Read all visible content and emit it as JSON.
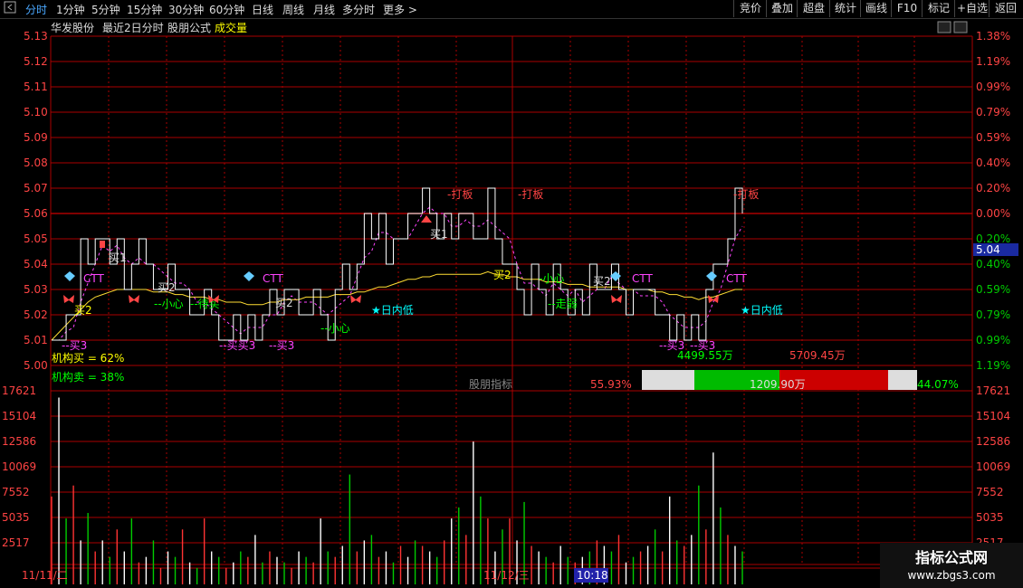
{
  "toolbar": {
    "menu_icon": "menu-icon",
    "tabs": [
      "分时",
      "1分钟",
      "5分钟",
      "15分钟",
      "30分钟",
      "60分钟",
      "日线",
      "周线",
      "月线",
      "多分时",
      "更多"
    ],
    "active_tab": "分时",
    "right_buttons": [
      "竞价",
      "叠加",
      "超盘",
      "统计",
      "画线",
      "F10",
      "标记",
      "+自选",
      "返回"
    ]
  },
  "header": {
    "stock_name": "华发股份",
    "period": "最近2日分时",
    "formula": "股朋公式",
    "volume_label": "成交量"
  },
  "price_axis": {
    "left_labels": [
      "5.13",
      "5.12",
      "5.11",
      "5.10",
      "5.09",
      "5.08",
      "5.07",
      "5.06",
      "5.05",
      "5.04",
      "5.03",
      "5.02",
      "5.01",
      "5.00"
    ],
    "right_labels": [
      "1.38%",
      "1.19%",
      "0.99%",
      "0.79%",
      "0.59%",
      "0.40%",
      "0.20%",
      "0.00%",
      "0.20%",
      "0.40%",
      "0.59%",
      "0.79%",
      "0.99%",
      "1.19%"
    ],
    "current_price": "5.04"
  },
  "volume_axis": {
    "labels": [
      "17621",
      "15104",
      "12586",
      "10069",
      "7552",
      "5035",
      "2517"
    ]
  },
  "annotations": {
    "daban": "打板",
    "buy1": "买1",
    "buy2": "买2",
    "buy3": "买3",
    "buybuy3": "买买3",
    "careful": "小心",
    "ctt": "CTT",
    "intraday_low": "★日内低",
    "wait_buy": "待买",
    "weak": "走弱"
  },
  "stats": {
    "inst_buy": "机构买 = 62%",
    "inst_sell": "机构卖 = 38%",
    "indicator_label": "股朋指标",
    "left_pct": "55.93%",
    "mid_amount": "1209.90万",
    "right_pct": "44.07%",
    "amount_left": "4499.55万",
    "amount_right": "5709.45万"
  },
  "time_axis": {
    "day1": "11/11/二",
    "day2": "11/12/三",
    "cursor_time": "10:18"
  },
  "watermark": {
    "title": "指标公式网",
    "url": "www.zbgs3.com"
  },
  "colors": {
    "red": "#ff3333",
    "green": "#00cc00",
    "yellow": "#ffff00",
    "white": "#ffffff",
    "magenta": "#ff44ff",
    "cyan": "#00ffff",
    "grid": "#aa0000",
    "axis_text": "#ff4444"
  },
  "chart_data": {
    "type": "line",
    "ylim": [
      5.0,
      5.13
    ],
    "price_series": [
      5.01,
      5.01,
      5.02,
      5.02,
      5.05,
      5.04,
      5.05,
      5.05,
      5.04,
      5.05,
      5.03,
      5.04,
      5.05,
      5.04,
      5.03,
      5.03,
      5.04,
      5.03,
      5.03,
      5.02,
      5.02,
      5.03,
      5.02,
      5.01,
      5.01,
      5.02,
      5.01,
      5.02,
      5.01,
      5.02,
      5.03,
      5.02,
      5.03,
      5.03,
      5.02,
      5.02,
      5.03,
      5.02,
      5.01,
      5.03,
      5.04,
      5.03,
      5.04,
      5.06,
      5.05,
      5.06,
      5.04,
      5.05,
      5.05,
      5.06,
      5.06,
      5.07,
      5.06,
      5.05,
      5.06,
      5.05,
      5.06,
      5.06,
      5.05,
      5.05,
      5.07,
      5.05,
      5.04,
      5.04,
      5.03,
      5.02,
      5.04,
      5.03,
      5.02,
      5.04,
      5.03,
      5.02,
      5.03,
      5.02,
      5.04,
      5.03,
      5.03,
      5.04,
      5.03,
      5.02,
      5.03,
      5.03,
      5.03,
      5.02,
      5.02,
      5.01,
      5.02,
      5.01,
      5.02,
      5.01,
      5.03,
      5.04,
      5.04,
      5.05,
      5.07,
      5.06
    ],
    "avg_series": [
      5.01,
      5.013,
      5.016,
      5.019,
      5.022,
      5.025,
      5.027,
      5.028,
      5.029,
      5.03,
      5.03,
      5.03,
      5.03,
      5.03,
      5.029,
      5.029,
      5.029,
      5.028,
      5.028,
      5.027,
      5.027,
      5.027,
      5.026,
      5.026,
      5.025,
      5.025,
      5.025,
      5.024,
      5.024,
      5.024,
      5.025,
      5.025,
      5.026,
      5.026,
      5.026,
      5.027,
      5.027,
      5.027,
      5.027,
      5.028,
      5.028,
      5.028,
      5.029,
      5.029,
      5.03,
      5.031,
      5.031,
      5.032,
      5.033,
      5.034,
      5.034,
      5.035,
      5.035,
      5.036,
      5.036,
      5.036,
      5.036,
      5.036,
      5.036,
      5.036,
      5.037,
      5.036,
      5.036,
      5.035,
      5.035,
      5.034,
      5.034,
      5.034,
      5.033,
      5.033,
      5.033,
      5.032,
      5.032,
      5.032,
      5.031,
      5.031,
      5.031,
      5.031,
      5.031,
      5.03,
      5.03,
      5.03,
      5.03,
      5.029,
      5.029,
      5.028,
      5.028,
      5.027,
      5.027,
      5.026,
      5.027,
      5.027,
      5.028,
      5.029,
      5.03,
      5.03
    ],
    "volume_series": [
      8000,
      17000,
      6000,
      9000,
      4000,
      6500,
      3000,
      4000,
      2500,
      5000,
      3000,
      6000,
      2000,
      2500,
      4000,
      1500,
      3000,
      2500,
      5000,
      2000,
      1500,
      6000,
      3000,
      2500,
      1500,
      2000,
      3000,
      2500,
      4500,
      2000,
      3000,
      2500,
      2000,
      1500,
      3000,
      2500,
      2000,
      6000,
      3000,
      2500,
      3500,
      10000,
      3000,
      4000,
      4500,
      2500,
      3000,
      2000,
      3500,
      2500,
      4000,
      3500,
      3000,
      2500,
      4000,
      6000,
      7000,
      4500,
      13000,
      8000,
      6000,
      3000,
      5000,
      6000,
      4000,
      7500,
      3500,
      3000,
      2500,
      2000,
      3500,
      2500,
      2000,
      2500,
      3000,
      4000,
      3500,
      3000,
      4500,
      2000,
      2500,
      3000,
      3500,
      5000,
      3000,
      8000,
      4000,
      3500,
      4500,
      9000,
      5000,
      12000,
      7000,
      4500,
      3500,
      3000
    ],
    "volume_ylim": [
      0,
      17621
    ]
  }
}
